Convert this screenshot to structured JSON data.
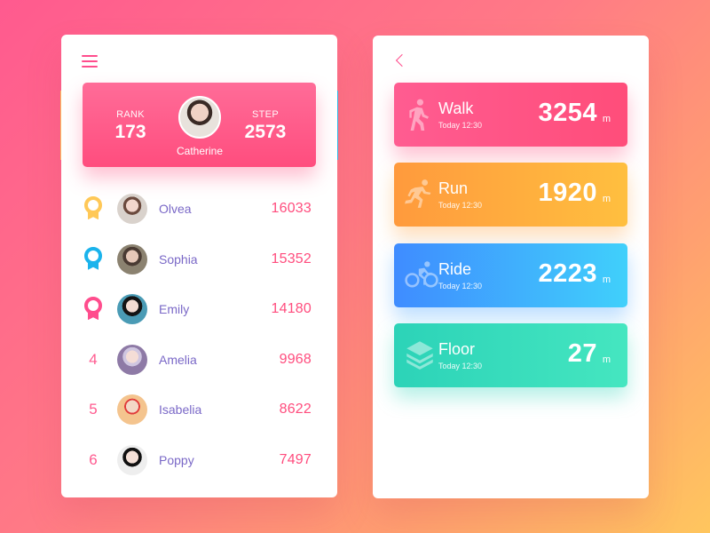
{
  "left": {
    "header": {
      "menu_icon": "hamburger-menu-icon"
    },
    "profile": {
      "rank_label": "RANK",
      "rank_value": "173",
      "step_label": "STEP",
      "step_value": "2573",
      "name": "Catherine"
    },
    "leaderboard": [
      {
        "rank": "1",
        "medal": "gold",
        "name": "Olvea",
        "score": "16033"
      },
      {
        "rank": "2",
        "medal": "blue",
        "name": "Sophia",
        "score": "15352"
      },
      {
        "rank": "3",
        "medal": "pink",
        "name": "Emily",
        "score": "14180"
      },
      {
        "rank": "4",
        "medal": "",
        "name": "Amelia",
        "score": "9968"
      },
      {
        "rank": "5",
        "medal": "",
        "name": "Isabelia",
        "score": "8622"
      },
      {
        "rank": "6",
        "medal": "",
        "name": "Poppy",
        "score": "7497"
      }
    ]
  },
  "right": {
    "header": {
      "back_icon": "chevron-left-icon"
    },
    "activities": [
      {
        "name": "Walk",
        "time": "Today 12:30",
        "value": "3254",
        "unit": "m",
        "icon": "walk-icon"
      },
      {
        "name": "Run",
        "time": "Today 12:30",
        "value": "1920",
        "unit": "m",
        "icon": "run-icon"
      },
      {
        "name": "Ride",
        "time": "Today 12:30",
        "value": "2223",
        "unit": "m",
        "icon": "bike-icon"
      },
      {
        "name": "Floor",
        "time": "Today 12:30",
        "value": "27",
        "unit": "m",
        "icon": "layers-icon"
      }
    ]
  },
  "colors": {
    "accent_pink": "#ff4d7e",
    "name_purple": "#7a68c7",
    "medal_gold": "#ffc857",
    "medal_blue": "#1ab3ec",
    "medal_pink": "#ff4d8d",
    "walk_gradient": [
      "#ff5c91",
      "#ff4d7a"
    ],
    "run_gradient": [
      "#ff9a3d",
      "#ffbf3f"
    ],
    "ride_gradient": [
      "#3f8cff",
      "#40d0fb"
    ],
    "floor_gradient": [
      "#2cd3b8",
      "#45e6c0"
    ]
  }
}
